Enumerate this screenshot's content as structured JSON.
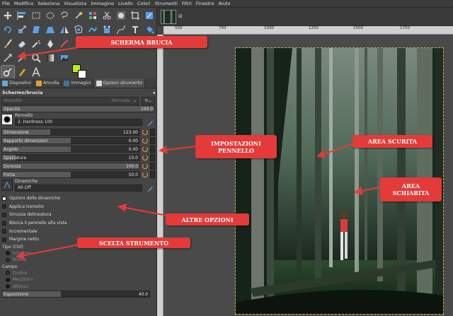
{
  "menubar": [
    "File",
    "Modifica",
    "Seleziona",
    "Visualizza",
    "Immagine",
    "Livello",
    "Colori",
    "Strumenti",
    "Filtri",
    "Finestre",
    "Aiuto"
  ],
  "tabs": [
    {
      "label": "Dispositivi",
      "color": "#6fa5e0"
    },
    {
      "label": "Annulla",
      "color": "#e0a030"
    },
    {
      "label": "Immagini",
      "color": "#4b6f9b"
    },
    {
      "label": "Opzioni strumento",
      "color": "#d9d9d9"
    }
  ],
  "panel": {
    "title": "Schermo/brucia",
    "mode_label": "Modalità",
    "mode_value": "Normale",
    "opacity": {
      "label": "Opacità",
      "value": "100.0"
    },
    "brush_label": "Pennello",
    "brush_name": "2. Hardness 100",
    "sliders": [
      {
        "label": "Dimensione",
        "value": "123.00",
        "fraction": 0.35
      },
      {
        "label": "Rapporto dimensioni",
        "value": "0.00",
        "fraction": 0.5
      },
      {
        "label": "Angolo",
        "value": "0.00",
        "fraction": 0.5
      },
      {
        "label": "Spaziatura",
        "value": "10.0",
        "fraction": 0.1
      },
      {
        "label": "Durezza",
        "value": "100.0",
        "fraction": 1.0
      },
      {
        "label": "Forza",
        "value": "50.0",
        "fraction": 0.5
      }
    ],
    "dynamics_label": "Dinamiche",
    "dynamics_value": "All-Off",
    "checks": [
      {
        "label": "Opzioni delle dinamiche",
        "on": true,
        "dim": false
      },
      {
        "label": "Applica tremolio",
        "on": false,
        "dim": false
      },
      {
        "label": "Smussa delineatura",
        "on": false,
        "dim": false
      },
      {
        "label": "Blocca il pennello alla vista",
        "on": false,
        "dim": false
      },
      {
        "label": "Incrementale",
        "on": false,
        "dim": false
      },
      {
        "label": "Margine netto",
        "on": false,
        "dim": false
      }
    ],
    "type_label": "Tipo  (Ctrl)",
    "type_options": [
      "Schermo",
      "Brucia"
    ],
    "range_label": "Campo",
    "range_options": [
      "Ombre",
      "Mezzitoni",
      "Alteluci"
    ],
    "exposure": {
      "label": "Esposizione",
      "value": "40.0",
      "fraction": 0.4
    }
  },
  "ruler_labels": [
    "500",
    "750",
    "1000",
    "1250",
    "1500",
    "1750"
  ],
  "callouts": {
    "scherma": "SCHERMA BRUCIA",
    "impostazioni_1": "IMPOSTAZIONI",
    "impostazioni_2": "PENNELLO",
    "altre": "ALTRE OPZIONI",
    "scelta": "SCELTA STRUMENTO",
    "scurita": "AREA SCURITA",
    "schiarita_1": "AREA",
    "schiarita_2": "SCHIARITA"
  },
  "colors": {
    "foreground": "#b9f00c",
    "background": "#ffffff",
    "callout": "#e53a3a"
  }
}
